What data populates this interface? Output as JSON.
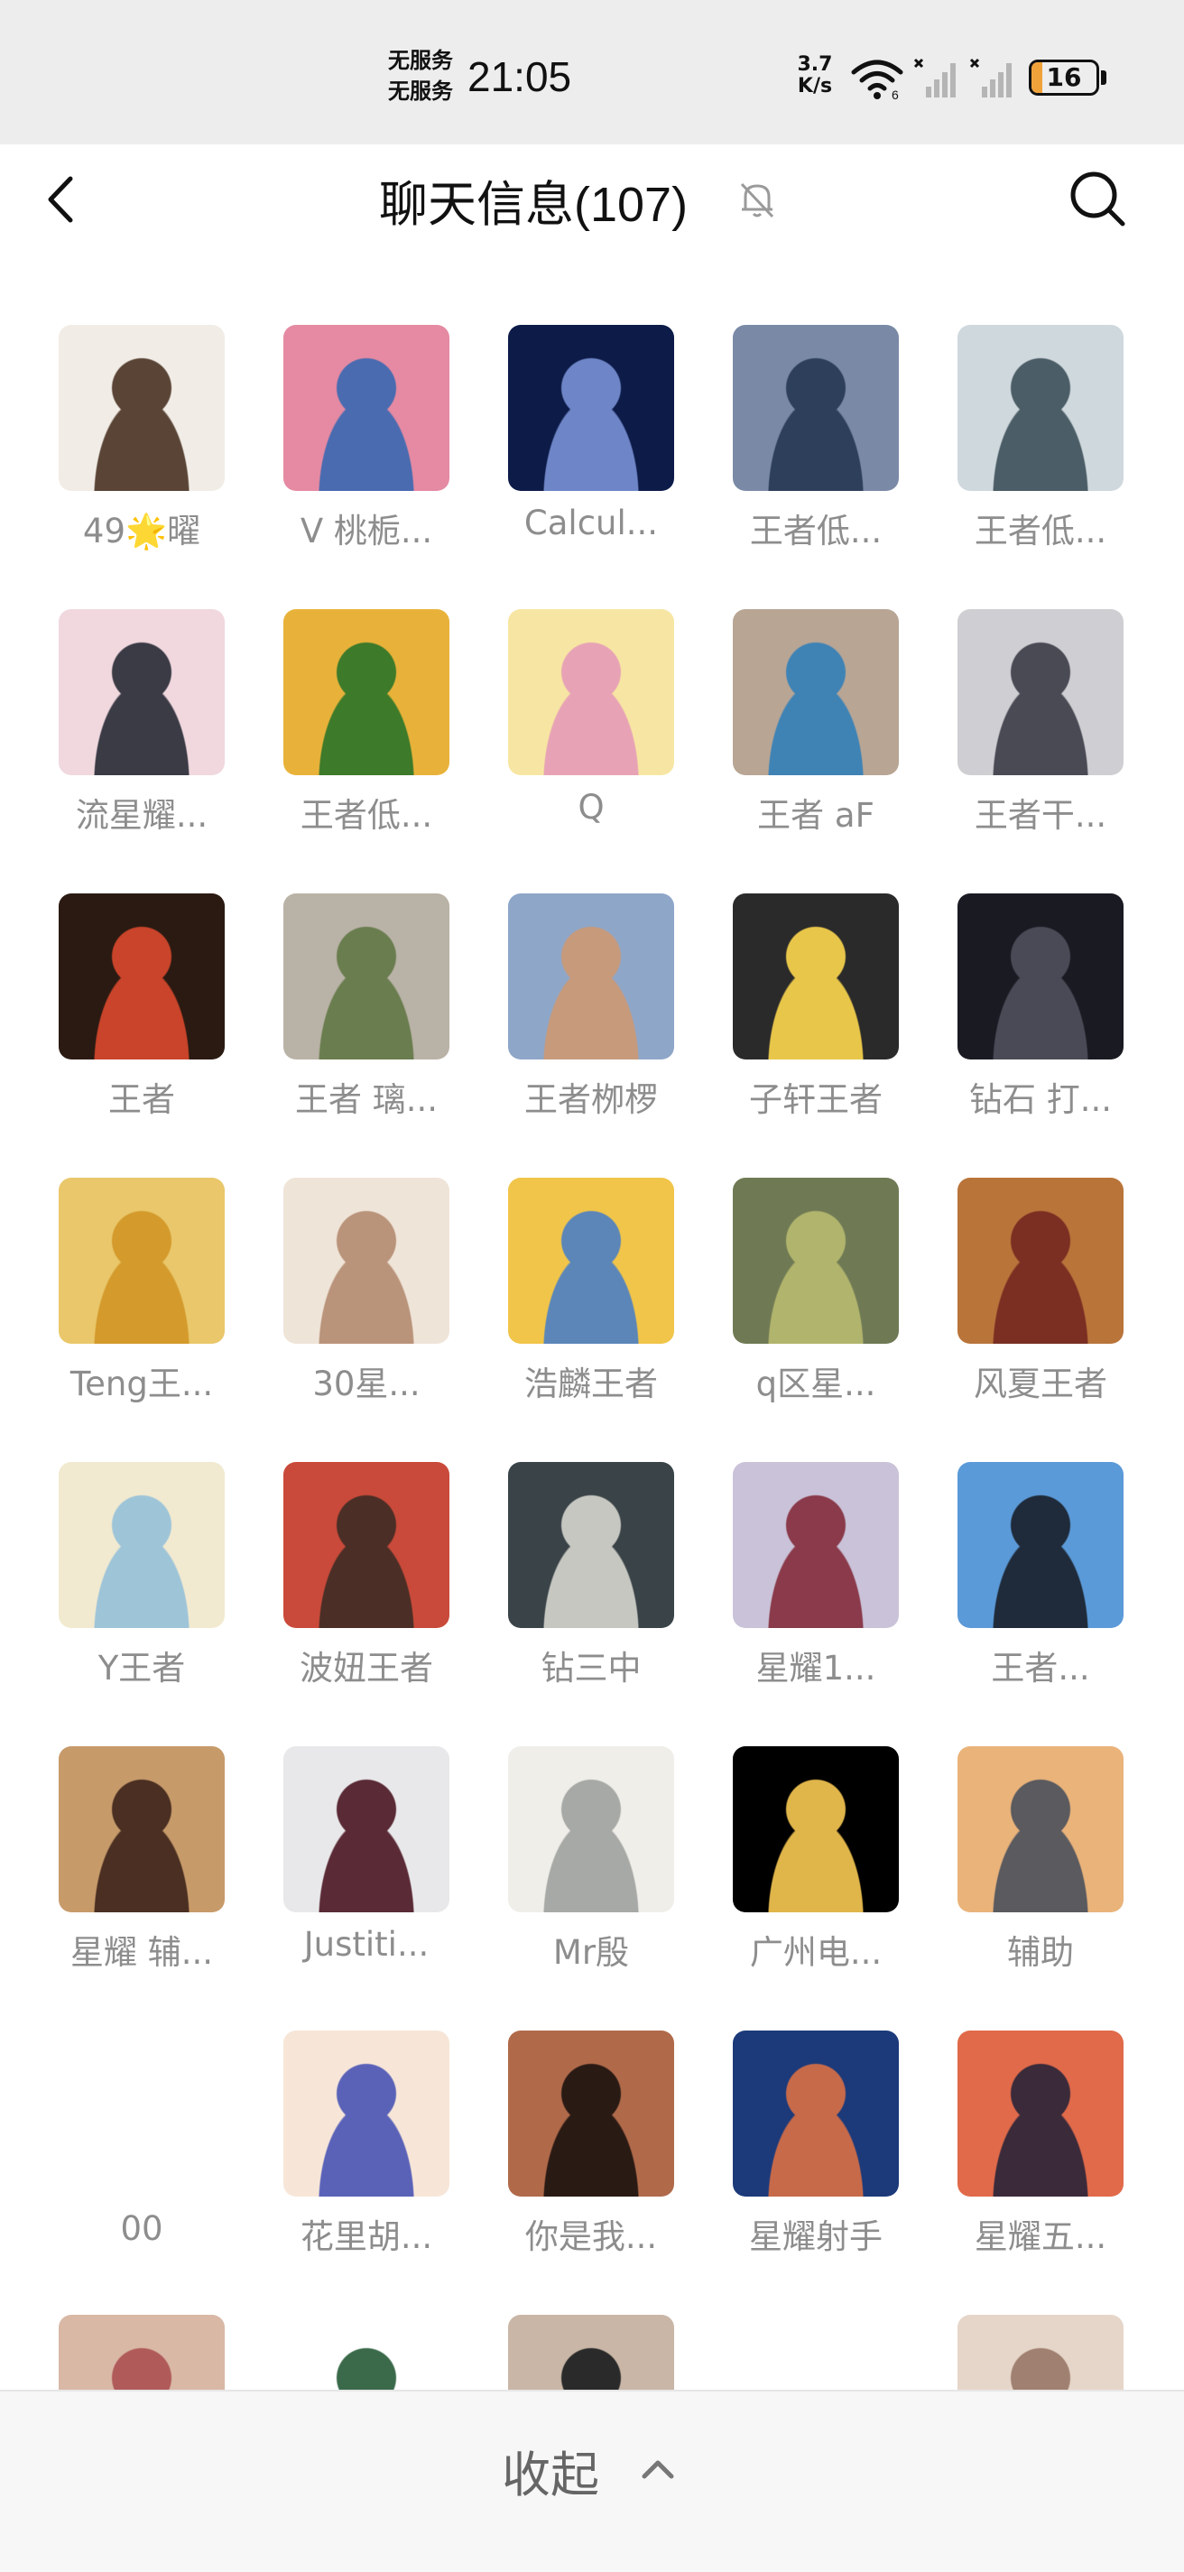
{
  "status_bar": {
    "carrier_1": "无服务",
    "carrier_2": "无服务",
    "time": "21:05",
    "net_speed_value": "3.7",
    "net_speed_unit": "K/s",
    "battery": "16",
    "battery_level": 0.16
  },
  "header": {
    "title": "聊天信息(107)",
    "back_icon": "chevron-left-icon",
    "mute_icon": "bell-muted-icon",
    "search_icon": "search-icon"
  },
  "members": [
    {
      "name": "49🌟曜",
      "colors": [
        "#f1ede6",
        "#5a4436"
      ]
    },
    {
      "name": "V  桃栀...",
      "colors": [
        "#e58aa2",
        "#4a6bb0"
      ]
    },
    {
      "name": "Calcul...",
      "colors": [
        "#0d1b48",
        "#6e86c8"
      ]
    },
    {
      "name": "王者低...",
      "colors": [
        "#7a8aa6",
        "#2d3f5a"
      ]
    },
    {
      "name": "王者低...",
      "colors": [
        "#cfd8dd",
        "#4b5d66"
      ]
    },
    {
      "name": "流星耀...",
      "colors": [
        "#f0d8de",
        "#3b3b46"
      ]
    },
    {
      "name": "王者低...",
      "colors": [
        "#e8b23a",
        "#3d7a2a"
      ]
    },
    {
      "name": "Q",
      "colors": [
        "#f7e6a3",
        "#e7a3b5"
      ]
    },
    {
      "name": "王者 aF",
      "colors": [
        "#b8a594",
        "#3f83b5"
      ]
    },
    {
      "name": "王者干...",
      "colors": [
        "#cfcfd3",
        "#4a4a55"
      ]
    },
    {
      "name": "王者",
      "colors": [
        "#2a1a12",
        "#c9442a"
      ]
    },
    {
      "name": "王者 璃...",
      "colors": [
        "#b9b2a6",
        "#6a7d4f"
      ]
    },
    {
      "name": "王者栁椤",
      "colors": [
        "#8ea6c8",
        "#c79a7c"
      ]
    },
    {
      "name": "子轩王者",
      "colors": [
        "#2a2a2a",
        "#e8c64a"
      ]
    },
    {
      "name": "钻石 打...",
      "colors": [
        "#1a1a22",
        "#4a4a57"
      ]
    },
    {
      "name": "Teng王...",
      "colors": [
        "#e9c76a",
        "#d49a2c"
      ]
    },
    {
      "name": "30星...",
      "colors": [
        "#efe4d8",
        "#b9937a"
      ]
    },
    {
      "name": "浩麟王者",
      "colors": [
        "#f1c54a",
        "#5c86b8"
      ]
    },
    {
      "name": "q区星...",
      "colors": [
        "#6f7a55",
        "#b1b46c"
      ]
    },
    {
      "name": "风夏王者",
      "colors": [
        "#b9743a",
        "#7a2f22"
      ]
    },
    {
      "name": "Y王者",
      "colors": [
        "#f1ead0",
        "#9ec4d8"
      ]
    },
    {
      "name": "波妞王者",
      "colors": [
        "#c94a3a",
        "#4b2e26"
      ]
    },
    {
      "name": "钻三中",
      "colors": [
        "#3a4448",
        "#c7c7c2"
      ]
    },
    {
      "name": "星耀1...",
      "colors": [
        "#c9c2d8",
        "#8a3a4a"
      ]
    },
    {
      "name": "王者...",
      "colors": [
        "#5b9ad8",
        "#1f2b3a"
      ]
    },
    {
      "name": "星耀 辅...",
      "colors": [
        "#c79a6a",
        "#4a2f22"
      ]
    },
    {
      "name": "Justiti...",
      "colors": [
        "#e8e8ea",
        "#5a2a36"
      ]
    },
    {
      "name": "Mr殷",
      "colors": [
        "#f0eee9",
        "#a7a9a6"
      ]
    },
    {
      "name": "广州电...",
      "colors": [
        "#000000",
        "#e0b54a"
      ]
    },
    {
      "name": "辅助",
      "colors": [
        "#e9b37a",
        "#5a5a5f"
      ]
    },
    {
      "name": "00",
      "colors": [
        "#ffffff",
        "#ffffff"
      ]
    },
    {
      "name": "花里胡...",
      "colors": [
        "#f7e6d8",
        "#5a62b8"
      ]
    },
    {
      "name": "你是我...",
      "colors": [
        "#b06a4a",
        "#2a1a14"
      ]
    },
    {
      "name": "星耀射手",
      "colors": [
        "#1c3a7a",
        "#c76a4a"
      ]
    },
    {
      "name": "星耀五...",
      "colors": [
        "#e06a4a",
        "#3a2a3a"
      ]
    },
    {
      "name": "",
      "colors": [
        "#d9b8a6",
        "#b05a5a"
      ]
    },
    {
      "name": "",
      "colors": [
        "#ffffff",
        "#3a6a4a"
      ]
    },
    {
      "name": "",
      "colors": [
        "#c9b6a6",
        "#2a2a2a"
      ]
    },
    {
      "name": "",
      "colors": [
        "#ffffff",
        "#ffffff"
      ]
    },
    {
      "name": "",
      "colors": [
        "#e6d6c9",
        "#a08070"
      ]
    }
  ],
  "footer": {
    "collapse_label": "收起",
    "collapse_icon": "chevron-up-icon"
  }
}
